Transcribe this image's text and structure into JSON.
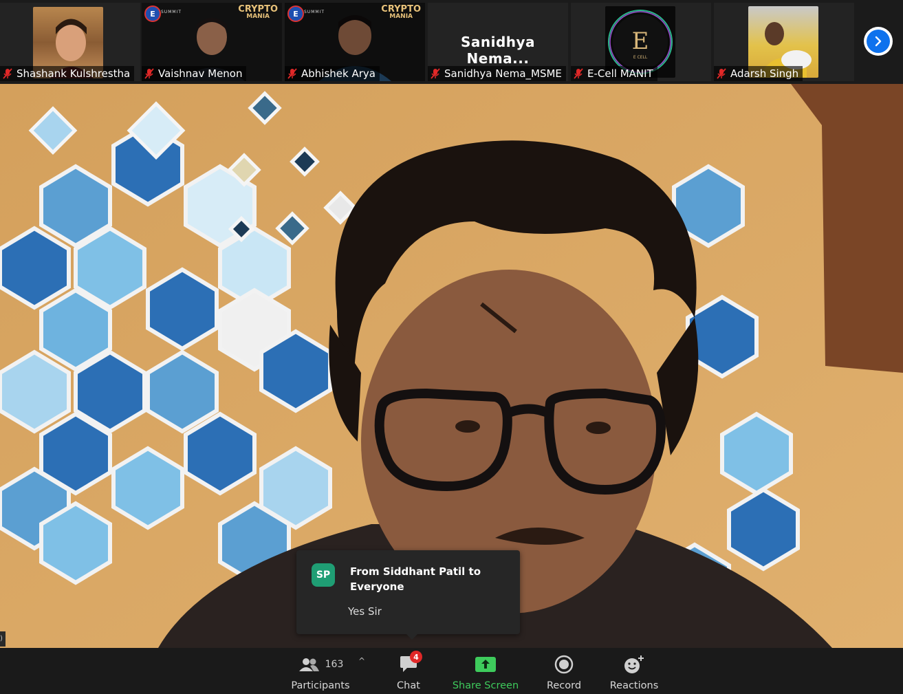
{
  "participants_strip": [
    {
      "name": "Shashank Kulshrestha",
      "muted": true,
      "type": "video"
    },
    {
      "name": "Vaishnav Menon",
      "muted": true,
      "type": "video",
      "overlay_brand": "E SUMMIT",
      "overlay_brand2": "CRYPTO",
      "overlay_brand2_sub": "MANIA"
    },
    {
      "name": "Abhishek Arya",
      "muted": true,
      "type": "video",
      "overlay_brand": "E SUMMIT",
      "overlay_brand2": "CRYPTO",
      "overlay_brand2_sub": "MANIA"
    },
    {
      "name": "Sanidhya Nema_MSME",
      "muted": true,
      "type": "name-only",
      "display_name": "Sanidhya  Nema..."
    },
    {
      "name": "E-Cell MANIT",
      "muted": true,
      "type": "logo",
      "logo_letter": "E",
      "logo_text": "E CELL"
    },
    {
      "name": "Adarsh Singh",
      "muted": true,
      "type": "video"
    }
  ],
  "next_page_icon": "chevron-right-icon",
  "chat_toast": {
    "avatar_initials": "SP",
    "from": "From Siddhant Patil to Everyone",
    "message": "Yes Sir",
    "avatar_color": "#1f9e74"
  },
  "toolbar": {
    "participants": {
      "label": "Participants",
      "count": "163",
      "icon": "participants-icon"
    },
    "chat": {
      "label": "Chat",
      "badge": "4",
      "icon": "chat-icon"
    },
    "share": {
      "label": "Share Screen",
      "icon": "share-screen-icon",
      "color": "#3ecb5c"
    },
    "record": {
      "label": "Record",
      "icon": "record-icon"
    },
    "reactions": {
      "label": "Reactions",
      "icon": "reactions-icon"
    }
  },
  "colors": {
    "mute_red": "#e02828",
    "accent_blue": "#0e72ed",
    "background": "#1a1a1a"
  }
}
